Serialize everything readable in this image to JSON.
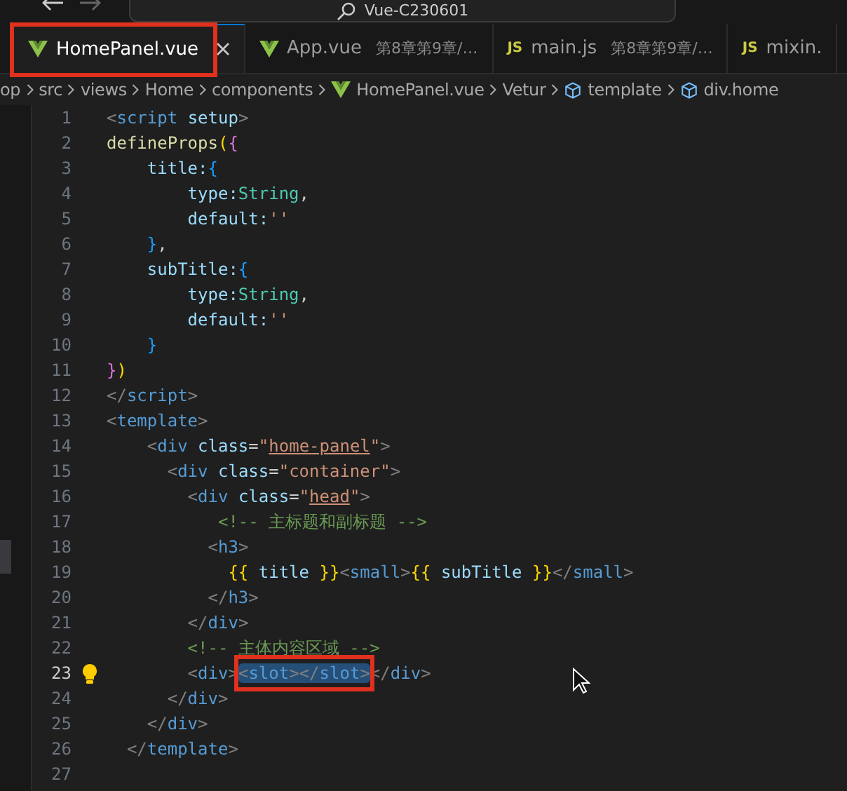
{
  "title_bar": {
    "search": "Vue-C230601"
  },
  "tabs": [
    {
      "label": "HomePanel.vue",
      "kind": "vue",
      "selected": true,
      "annotated": true
    },
    {
      "label": "App.vue",
      "description": "第8章第9章/…",
      "kind": "vue",
      "selected": false,
      "annotated": false
    },
    {
      "label": "main.js",
      "description": "第8章第9章/…",
      "kind": "js",
      "icon_text": "JS",
      "selected": false,
      "annotated": false
    },
    {
      "label": "mixin.",
      "kind": "js",
      "icon_text": "JS",
      "selected": false,
      "annotated": false
    }
  ],
  "breadcrumb": [
    {
      "label": "op",
      "kind": "folder"
    },
    {
      "label": "src",
      "kind": "folder"
    },
    {
      "label": "views",
      "kind": "folder"
    },
    {
      "label": "Home",
      "kind": "folder"
    },
    {
      "label": "components",
      "kind": "folder"
    },
    {
      "label": "HomePanel.vue",
      "kind": "vue"
    },
    {
      "label": "Vetur",
      "kind": "folder"
    },
    {
      "label": "template",
      "kind": "symbol"
    },
    {
      "label": "div.home",
      "kind": "symbol"
    }
  ],
  "editor": {
    "lines": [
      {
        "number": "1",
        "active": false,
        "lightbulb": false,
        "tokens": [
          {
            "kind": "punct",
            "text": "<"
          },
          {
            "kind": "tag",
            "text": "script"
          },
          {
            "kind": "attr",
            "text": " setup"
          },
          {
            "kind": "punct",
            "text": ">"
          }
        ]
      },
      {
        "number": "2",
        "active": false,
        "lightbulb": false,
        "tokens": [
          {
            "kind": "fn",
            "text": "defineProps"
          },
          {
            "kind": "b1",
            "text": "("
          },
          {
            "kind": "b2",
            "text": "{"
          }
        ]
      },
      {
        "number": "3",
        "active": false,
        "lightbulb": false,
        "tokens": [
          {
            "kind": "attr",
            "text": "    title:"
          },
          {
            "kind": "b3",
            "text": "{"
          }
        ]
      },
      {
        "number": "4",
        "active": false,
        "lightbulb": false,
        "tokens": [
          {
            "kind": "attr",
            "text": "        type:"
          },
          {
            "kind": "type",
            "text": "String"
          },
          {
            "kind": "text",
            "text": ","
          }
        ]
      },
      {
        "number": "5",
        "active": false,
        "lightbulb": false,
        "tokens": [
          {
            "kind": "attr",
            "text": "        default:"
          },
          {
            "kind": "str",
            "text": "''"
          }
        ]
      },
      {
        "number": "6",
        "active": false,
        "lightbulb": false,
        "tokens": [
          {
            "kind": "b3",
            "text": "    }"
          },
          {
            "kind": "text",
            "text": ","
          }
        ]
      },
      {
        "number": "7",
        "active": false,
        "lightbulb": false,
        "tokens": [
          {
            "kind": "attr",
            "text": "    subTitle:"
          },
          {
            "kind": "b3",
            "text": "{"
          }
        ]
      },
      {
        "number": "8",
        "active": false,
        "lightbulb": false,
        "tokens": [
          {
            "kind": "attr",
            "text": "        type:"
          },
          {
            "kind": "type",
            "text": "String"
          },
          {
            "kind": "text",
            "text": ","
          }
        ]
      },
      {
        "number": "9",
        "active": false,
        "lightbulb": false,
        "tokens": [
          {
            "kind": "attr",
            "text": "        default:"
          },
          {
            "kind": "str",
            "text": "''"
          }
        ]
      },
      {
        "number": "10",
        "active": false,
        "lightbulb": false,
        "tokens": [
          {
            "kind": "b3",
            "text": "    }"
          }
        ]
      },
      {
        "number": "11",
        "active": false,
        "lightbulb": false,
        "tokens": [
          {
            "kind": "b2",
            "text": "}"
          },
          {
            "kind": "b1",
            "text": ")"
          }
        ]
      },
      {
        "number": "12",
        "active": false,
        "lightbulb": false,
        "tokens": [
          {
            "kind": "punct",
            "text": "</"
          },
          {
            "kind": "tag",
            "text": "script"
          },
          {
            "kind": "punct",
            "text": ">"
          }
        ]
      },
      {
        "number": "13",
        "active": false,
        "lightbulb": false,
        "tokens": [
          {
            "kind": "punct",
            "text": "<"
          },
          {
            "kind": "tag",
            "text": "template"
          },
          {
            "kind": "punct",
            "text": ">"
          }
        ]
      },
      {
        "number": "14",
        "active": false,
        "lightbulb": false,
        "tokens": [
          {
            "kind": "punct",
            "text": "    <"
          },
          {
            "kind": "tag",
            "text": "div"
          },
          {
            "kind": "attr",
            "text": " class"
          },
          {
            "kind": "text",
            "text": "="
          },
          {
            "kind": "str",
            "text": "\""
          },
          {
            "kind": "link",
            "text": "home-panel"
          },
          {
            "kind": "str",
            "text": "\""
          },
          {
            "kind": "punct",
            "text": ">"
          }
        ]
      },
      {
        "number": "15",
        "active": false,
        "lightbulb": false,
        "tokens": [
          {
            "kind": "punct",
            "text": "      <"
          },
          {
            "kind": "tag",
            "text": "div"
          },
          {
            "kind": "attr",
            "text": " class"
          },
          {
            "kind": "text",
            "text": "="
          },
          {
            "kind": "str",
            "text": "\"container\""
          },
          {
            "kind": "punct",
            "text": ">"
          }
        ]
      },
      {
        "number": "16",
        "active": false,
        "lightbulb": false,
        "tokens": [
          {
            "kind": "punct",
            "text": "        <"
          },
          {
            "kind": "tag",
            "text": "div"
          },
          {
            "kind": "attr",
            "text": " class"
          },
          {
            "kind": "text",
            "text": "="
          },
          {
            "kind": "str",
            "text": "\""
          },
          {
            "kind": "link",
            "text": "head"
          },
          {
            "kind": "str",
            "text": "\""
          },
          {
            "kind": "punct",
            "text": ">"
          }
        ]
      },
      {
        "number": "17",
        "active": false,
        "lightbulb": false,
        "tokens": [
          {
            "kind": "cmt",
            "text": "           <!-- 主标题和副标题 -->"
          }
        ]
      },
      {
        "number": "18",
        "active": false,
        "lightbulb": false,
        "tokens": [
          {
            "kind": "punct",
            "text": "          <"
          },
          {
            "kind": "tag",
            "text": "h3"
          },
          {
            "kind": "punct",
            "text": ">"
          }
        ]
      },
      {
        "number": "19",
        "active": false,
        "lightbulb": false,
        "tokens": [
          {
            "kind": "b1",
            "text": "            {{"
          },
          {
            "kind": "attr",
            "text": " title "
          },
          {
            "kind": "b1",
            "text": "}}"
          },
          {
            "kind": "punct",
            "text": "<"
          },
          {
            "kind": "tag",
            "text": "small"
          },
          {
            "kind": "punct",
            "text": ">"
          },
          {
            "kind": "b1",
            "text": "{{"
          },
          {
            "kind": "attr",
            "text": " subTitle "
          },
          {
            "kind": "b1",
            "text": "}}"
          },
          {
            "kind": "punct",
            "text": "</"
          },
          {
            "kind": "tag",
            "text": "small"
          },
          {
            "kind": "punct",
            "text": ">"
          }
        ]
      },
      {
        "number": "20",
        "active": false,
        "lightbulb": false,
        "tokens": [
          {
            "kind": "punct",
            "text": "          </"
          },
          {
            "kind": "tag",
            "text": "h3"
          },
          {
            "kind": "punct",
            "text": ">"
          }
        ]
      },
      {
        "number": "21",
        "active": false,
        "lightbulb": false,
        "tokens": [
          {
            "kind": "punct",
            "text": "        </"
          },
          {
            "kind": "tag",
            "text": "div"
          },
          {
            "kind": "punct",
            "text": ">"
          }
        ]
      },
      {
        "number": "22",
        "active": false,
        "lightbulb": false,
        "tokens": [
          {
            "kind": "cmt",
            "text": "        <!-- 主体内容区域 -->"
          }
        ]
      },
      {
        "number": "23",
        "active": true,
        "lightbulb": true,
        "tokens": [
          {
            "kind": "punct",
            "text": "        <"
          },
          {
            "kind": "tag",
            "text": "div"
          },
          {
            "kind": "punct",
            "text": ">"
          },
          {
            "kind": "selection",
            "annotated": true,
            "tokens": [
              {
                "kind": "punct",
                "text": "<"
              },
              {
                "kind": "tag",
                "text": "slot"
              },
              {
                "kind": "punct",
                "text": "></"
              },
              {
                "kind": "tag",
                "text": "slot"
              },
              {
                "kind": "punct",
                "text": ">"
              }
            ]
          },
          {
            "kind": "punct",
            "text": "</"
          },
          {
            "kind": "tag",
            "text": "div"
          },
          {
            "kind": "punct",
            "text": ">"
          }
        ]
      },
      {
        "number": "24",
        "active": false,
        "lightbulb": false,
        "tokens": [
          {
            "kind": "punct",
            "text": "      </"
          },
          {
            "kind": "tag",
            "text": "div"
          },
          {
            "kind": "punct",
            "text": ">"
          }
        ]
      },
      {
        "number": "25",
        "active": false,
        "lightbulb": false,
        "tokens": [
          {
            "kind": "punct",
            "text": "    </"
          },
          {
            "kind": "tag",
            "text": "div"
          },
          {
            "kind": "punct",
            "text": ">"
          }
        ]
      },
      {
        "number": "26",
        "active": false,
        "lightbulb": false,
        "tokens": [
          {
            "kind": "punct",
            "text": "  </"
          },
          {
            "kind": "tag",
            "text": "template"
          },
          {
            "kind": "punct",
            "text": ">"
          }
        ]
      },
      {
        "number": "27",
        "active": false,
        "lightbulb": false
      }
    ]
  }
}
